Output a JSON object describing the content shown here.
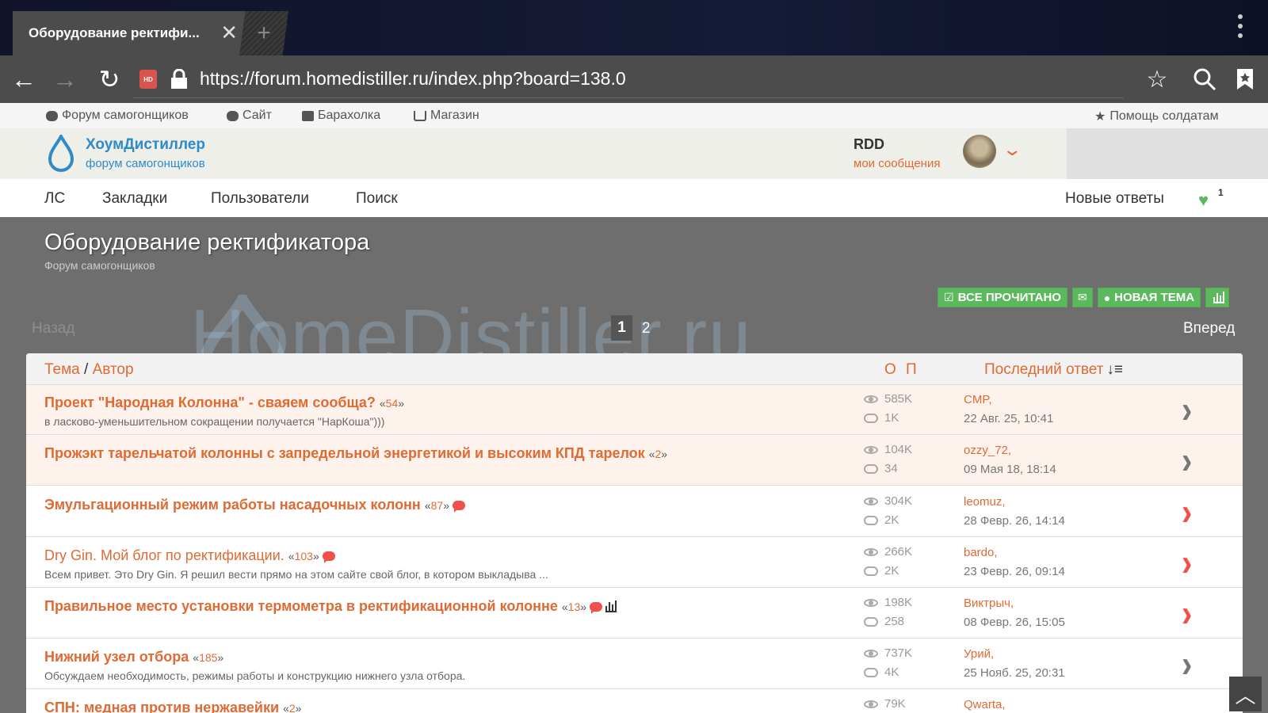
{
  "browser": {
    "tab_title": "Оборудование ректифи...",
    "url": "https://forum.homedistiller.ru/index.php?board=138.0",
    "site_badge": "HD"
  },
  "topnav": {
    "forum": "Форум самогонщиков",
    "site": "Сайт",
    "market": "Барахолка",
    "shop": "Магазин",
    "help": "Помощь солдатам"
  },
  "brand": {
    "title": "ХоумДистиллер",
    "subtitle": "форум самогонщиков"
  },
  "user": {
    "name": "RDD",
    "messages": "мои сообщения"
  },
  "mainnav": {
    "pm": "ЛС",
    "bookmarks": "Закладки",
    "users": "Пользователи",
    "search": "Поиск",
    "new_replies": "Новые ответы",
    "likes_count": "1"
  },
  "board": {
    "title": "Оборудование ректификатора",
    "subtitle": "Форум самогонщиков",
    "watermark": "HomeDistiller.ru"
  },
  "actions": {
    "mark_read": "ВСЕ ПРОЧИТАНО",
    "new_topic": "НОВАЯ ТЕМА"
  },
  "pager": {
    "back": "Назад",
    "forward": "Вперед",
    "pages": [
      "1",
      "2"
    ],
    "current": "1"
  },
  "table": {
    "col_topic": "Тема",
    "col_slash": "/",
    "col_author": "Автор",
    "col_o": "О",
    "col_p": "П",
    "col_last": "Последний ответ",
    "rows": [
      {
        "title": "Проект \"Народная Колонна\" - сваяем сообща?",
        "pages": "54",
        "desc": "в ласково-уменьшительном сокращении получается \"НарКоша\")))",
        "views": "585K",
        "replies": "1K",
        "last_user": "CMP,",
        "last_date": "22 Авг. 25, 10:41"
      },
      {
        "title": "Прожэкт тарельчатой колонны с запредельной энергетикой и высоким КПД тарелок",
        "pages": "2",
        "desc": "",
        "views": "104K",
        "replies": "34",
        "last_user": "ozzy_72,",
        "last_date": "09 Мая 18, 18:14"
      },
      {
        "title": "Эмульгационный режим работы насадочных колонн",
        "pages": "87",
        "desc": "",
        "views": "304K",
        "replies": "2K",
        "last_user": "leomuz,",
        "last_date": "28 Февр. 26, 14:14"
      },
      {
        "title": "Dry Gin. Мой блог по ректификации.",
        "pages": "103",
        "desc": "Всем привет. Это Dry Gin. Я решил вести прямо на этом сайте свой блог, в котором выкладыва ...",
        "views": "266K",
        "replies": "2K",
        "last_user": "bardo,",
        "last_date": "23 Февр. 26, 09:14"
      },
      {
        "title": "Правильное место установки термометра в ректификационной колонне",
        "pages": "13",
        "desc": "",
        "views": "198K",
        "replies": "258",
        "last_user": "Виктрыч,",
        "last_date": "08 Февр. 26, 15:05"
      },
      {
        "title": "Нижний узел отбора",
        "pages": "185",
        "desc": "Обсуждаем необходимость, режимы работы и конструкцию нижнего узла отбора.",
        "views": "737K",
        "replies": "4K",
        "last_user": "Урий,",
        "last_date": "25 Нояб. 25, 20:31"
      },
      {
        "title": "СПН: медная против нержавейки",
        "pages": "2",
        "desc": "",
        "views": "79K",
        "replies": "",
        "last_user": "Qwarta,",
        "last_date": ""
      }
    ]
  }
}
